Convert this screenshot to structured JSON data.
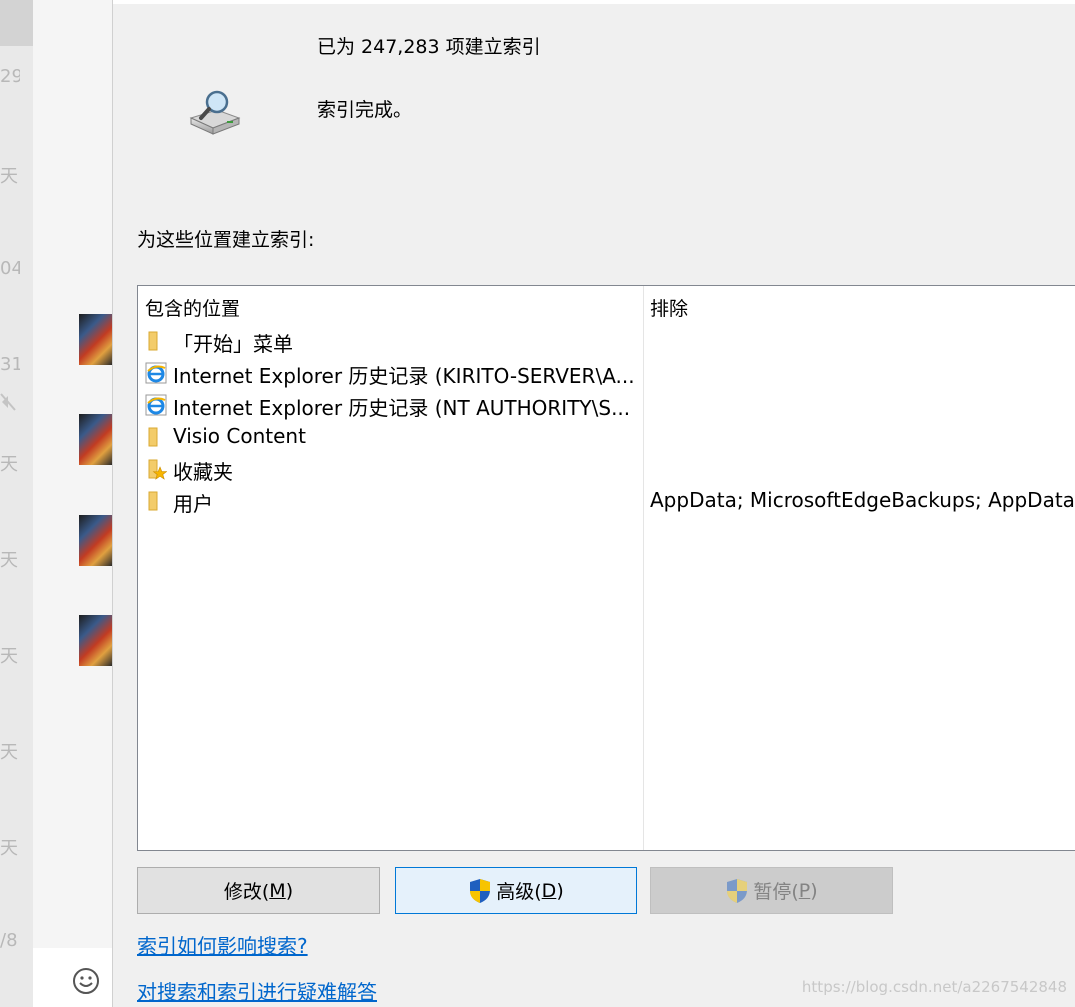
{
  "background_app": {
    "labels": [
      "29",
      "天",
      "04",
      "31",
      "天",
      "天",
      "天",
      "天",
      "天",
      "/8"
    ]
  },
  "index_status": {
    "count_text": "已为 247,283 项建立索引",
    "state_text": "索引完成。"
  },
  "locations": {
    "heading": "为这些位置建立索引:",
    "columns": {
      "included": "包含的位置",
      "excluded": "排除"
    },
    "rows": [
      {
        "icon": "folder-icon",
        "name": "「开始」菜单",
        "excluded": ""
      },
      {
        "icon": "internet-explorer-icon",
        "name": "Internet Explorer 历史记录 (KIRITO-SERVER\\A...",
        "excluded": ""
      },
      {
        "icon": "internet-explorer-icon",
        "name": "Internet Explorer 历史记录 (NT AUTHORITY\\S...",
        "excluded": ""
      },
      {
        "icon": "folder-icon",
        "name": "Visio Content",
        "excluded": ""
      },
      {
        "icon": "favorites-folder-icon",
        "name": "收藏夹",
        "excluded": ""
      },
      {
        "icon": "folder-icon",
        "name": "用户",
        "excluded": "AppData; MicrosoftEdgeBackups; AppData"
      }
    ]
  },
  "buttons": {
    "modify": {
      "label": "修改(",
      "mnemonic": "M",
      "suffix": ")"
    },
    "advanced": {
      "label": "高级(",
      "mnemonic": "D",
      "suffix": ")"
    },
    "pause": {
      "label": "暂停(",
      "mnemonic": "P",
      "suffix": ")"
    }
  },
  "links": {
    "how_affects": "索引如何影响搜索?",
    "troubleshoot": "对搜索和索引进行疑难解答"
  },
  "watermark": "https://blog.csdn.net/a2267542848",
  "colors": {
    "link": "#0066cc",
    "focus_border": "#0078d7",
    "panel_bg": "#f0f0f0"
  }
}
